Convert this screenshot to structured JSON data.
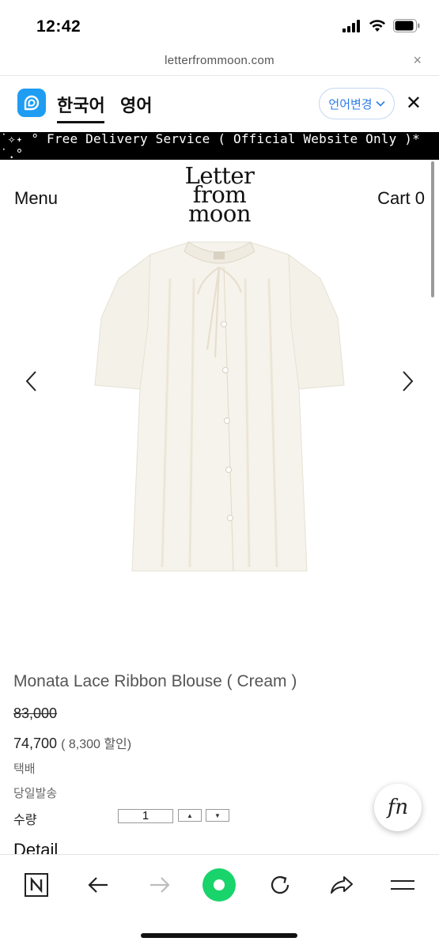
{
  "status": {
    "time": "12:42"
  },
  "browser": {
    "url": "letterfrommoon.com",
    "close_label": "×"
  },
  "translate": {
    "source_lang": "한국어",
    "target_lang": "영어",
    "change_label": "언어변경",
    "close_label": "✕"
  },
  "banner": {
    "text": "˙✧˖ ° Free Delivery Service ( Official Website Only )* ˙.°"
  },
  "site": {
    "menu_label": "Menu",
    "cart_label": "Cart 0",
    "logo_lines": [
      "Letter",
      "from",
      "moon"
    ]
  },
  "product": {
    "title": "Monata Lace Ribbon Blouse ( Cream )",
    "original_price": "83,000",
    "price": "74,700",
    "discount": "( 8,300 할인)",
    "shipping": "택배",
    "dispatch": "당일발송",
    "quantity_label": "수량",
    "quantity_value": "1",
    "qty_up": "▲",
    "qty_down": "▼",
    "color": "cream"
  },
  "detail_label": "Detail",
  "badge": {
    "text": "fn"
  },
  "colors": {
    "papago_blue": "#1e9df2",
    "accent_green": "#19d46b",
    "link_blue": "#2b7de9"
  }
}
